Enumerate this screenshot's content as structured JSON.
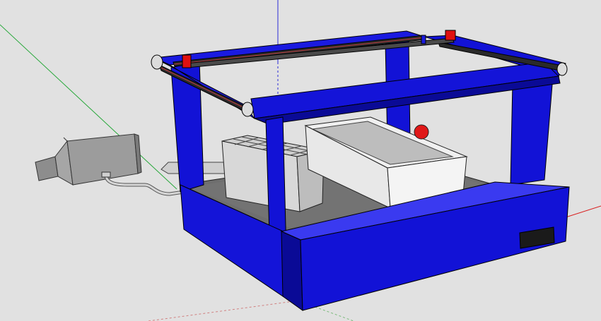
{
  "viewport": {
    "background": "#e1e1e1",
    "axes": {
      "red_axis_color": "#d92020",
      "green_axis_color": "#27a83a",
      "blue_axis_color": "#2a2ad8"
    }
  },
  "model": {
    "frame_color": "#1212d6",
    "frame_dark": "#0a0a96",
    "frame_light": "#3a3af0",
    "bed_color": "#6e6e6e",
    "rail_color": "#2a2a2a",
    "rail_accent": "#c04040",
    "carriage_color": "#e01010",
    "box_color": "#e8e8e8",
    "tray_color": "#dcdcdc",
    "motor_color": "#9c9c9c",
    "vent_color": "#1a1a1a",
    "knob_color": "#e01818",
    "components": [
      "gantry-frame",
      "x-rail-left",
      "x-rail-right",
      "y-rail-back",
      "y-rail-front",
      "carriage-left",
      "carriage-right",
      "work-bed",
      "grid-tray",
      "storage-box",
      "base-cabinet",
      "vent-grille",
      "motor-unit",
      "hose",
      "nozzle"
    ]
  }
}
